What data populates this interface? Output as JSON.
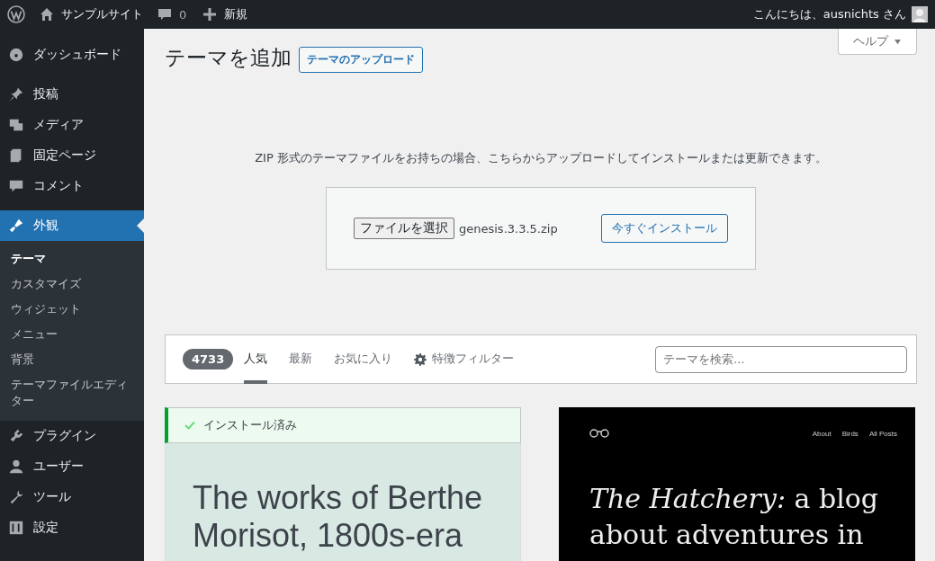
{
  "admin_bar": {
    "site_name": "サンプルサイト",
    "comments_count": "0",
    "new_label": "新規",
    "greeting": "こんにちは、ausnichts さん"
  },
  "sidebar": {
    "items": [
      {
        "label": "ダッシュボード",
        "selected": false
      },
      {
        "label": "投稿",
        "selected": false
      },
      {
        "label": "メディア",
        "selected": false
      },
      {
        "label": "固定ページ",
        "selected": false
      },
      {
        "label": "コメント",
        "selected": false
      },
      {
        "label": "外観",
        "selected": true,
        "children": [
          {
            "label": "テーマ",
            "selected": true
          },
          {
            "label": "カスタマイズ",
            "selected": false
          },
          {
            "label": "ウィジェット",
            "selected": false
          },
          {
            "label": "メニュー",
            "selected": false
          },
          {
            "label": "背景",
            "selected": false
          },
          {
            "label": "テーマファイルエディター",
            "selected": false
          }
        ]
      },
      {
        "label": "プラグイン",
        "selected": false
      },
      {
        "label": "ユーザー",
        "selected": false
      },
      {
        "label": "ツール",
        "selected": false
      },
      {
        "label": "設定",
        "selected": false
      }
    ]
  },
  "page": {
    "title": "テーマを追加",
    "upload_button": "テーマのアップロード",
    "help_button": "ヘルプ"
  },
  "upload": {
    "description": "ZIP 形式のテーマファイルをお持ちの場合、こちらからアップロードしてインストールまたは更新できます。",
    "choose_file_button": "ファイルを選択",
    "file_name": "genesis.3.3.5.zip",
    "install_button": "今すぐインストール"
  },
  "filter_bar": {
    "count": "4733",
    "tabs": [
      {
        "label": "人気",
        "selected": true
      },
      {
        "label": "最新",
        "selected": false
      },
      {
        "label": "お気に入り",
        "selected": false
      }
    ],
    "feature_filter": "特徴フィルター",
    "search": {
      "placeholder": "テーマを検索..."
    }
  },
  "themes": [
    {
      "installed": true,
      "installed_label": "インストール済み",
      "preview": {
        "kind": "light",
        "heading": "The works of Berthe Morisot, 1800s-era"
      }
    },
    {
      "installed": false,
      "preview": {
        "kind": "dark",
        "nav": [
          "About",
          "Birds",
          "All Posts"
        ],
        "heading": "*The Hatchery:* a blog about adventures in"
      }
    }
  ]
}
